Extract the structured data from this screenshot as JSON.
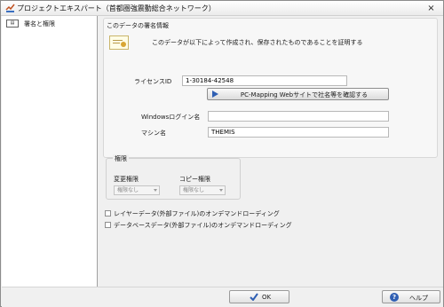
{
  "window": {
    "title": "プロジェクトエキスパート（首都圏強震動総合ネットワーク）",
    "close_glyph": "×"
  },
  "sidebar": {
    "items": [
      {
        "label": "署名と権限",
        "icon": "certificate-icon"
      }
    ]
  },
  "signature": {
    "heading": "このデータの署名情報",
    "description": "このデータが以下によって作成され、保存されたものであることを証明する",
    "license_label": "ライセンスID",
    "license_value": "1-30184-42548",
    "confirm_button": "PC-Mapping Webサイトで社名等を確認する",
    "windows_login_label": "Windowsログイン名",
    "windows_login_value": "",
    "machine_label": "マシン名",
    "machine_value": "THEMIS"
  },
  "permissions": {
    "title": "権限",
    "change_label": "変更権限",
    "change_value": "権限なし",
    "copy_label": "コピー権限",
    "copy_value": "権限なし"
  },
  "options": {
    "layer_ondemand": "レイヤーデータ(外部ファイル)のオンデマンドローディング",
    "database_ondemand": "データベースデータ(外部ファイル)のオンデマンドローディング"
  },
  "footer": {
    "ok_label": "OK",
    "help_label": "ヘルプ"
  },
  "colors": {
    "accent": "#2f5fb3",
    "window_bg": "#f0f0f0"
  }
}
